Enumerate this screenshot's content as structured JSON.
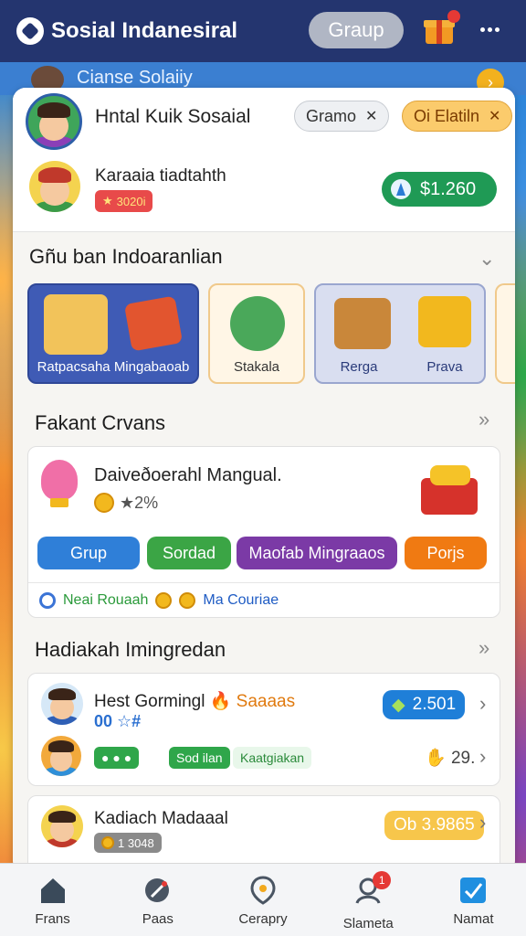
{
  "app": {
    "title": "Sosial Indanesiral",
    "group_label": "Graup"
  },
  "behind": {
    "title": "Cianse Solaiiy"
  },
  "profile": {
    "name": "Hntal Kuik Sosaial",
    "chip_grey": "Gramo",
    "chip_orange": "Oi Elatiln",
    "user2_name": "Karaaia tiadtahth",
    "level_text": "3020i",
    "coins": "$1.260"
  },
  "categories": {
    "title": "Gñu ban Indoaranlian",
    "items": [
      {
        "label": "Ratpacsaha Mingabaoab"
      },
      {
        "label": "Stakala"
      },
      {
        "label": "Rerga"
      },
      {
        "label": "Prava"
      }
    ]
  },
  "event": {
    "section_title": "Fakant Crvans",
    "title": "Daiveðoerahl Mangual.",
    "percent": "★2%",
    "buttons": [
      {
        "label": "Grup",
        "color": "#2f7fd8"
      },
      {
        "label": "Sordad",
        "color": "#3ba545"
      },
      {
        "label": "Maofab Mingraaos",
        "color": "#7b3aa6"
      },
      {
        "label": "Porjs",
        "color": "#f07a12"
      }
    ],
    "footer_left": "Neai Rouaah",
    "footer_right": "Ma Couriae"
  },
  "rewards": {
    "section_title": "Hadiakah Imingredan",
    "items": [
      {
        "name": "Hest Gormingl",
        "tag": "Saaaas",
        "sub": "00 ☆#",
        "value": "2.501",
        "pill_a": "● ● ●",
        "pill_b": "Sod ilan",
        "pill_c": "Kaatgiakan",
        "points": "29."
      },
      {
        "name": "Kadiach Madaaal",
        "level": "1 3048",
        "value": "Ob 3.9865"
      }
    ]
  },
  "nav": [
    {
      "label": "Frans"
    },
    {
      "label": "Paas"
    },
    {
      "label": "Cerapry"
    },
    {
      "label": "Slameta",
      "badge": "1"
    },
    {
      "label": "Namat"
    }
  ],
  "colors": {
    "topbar": "#24356f",
    "coin_green": "#1f9a55",
    "blue_accent": "#1f7fd8"
  }
}
